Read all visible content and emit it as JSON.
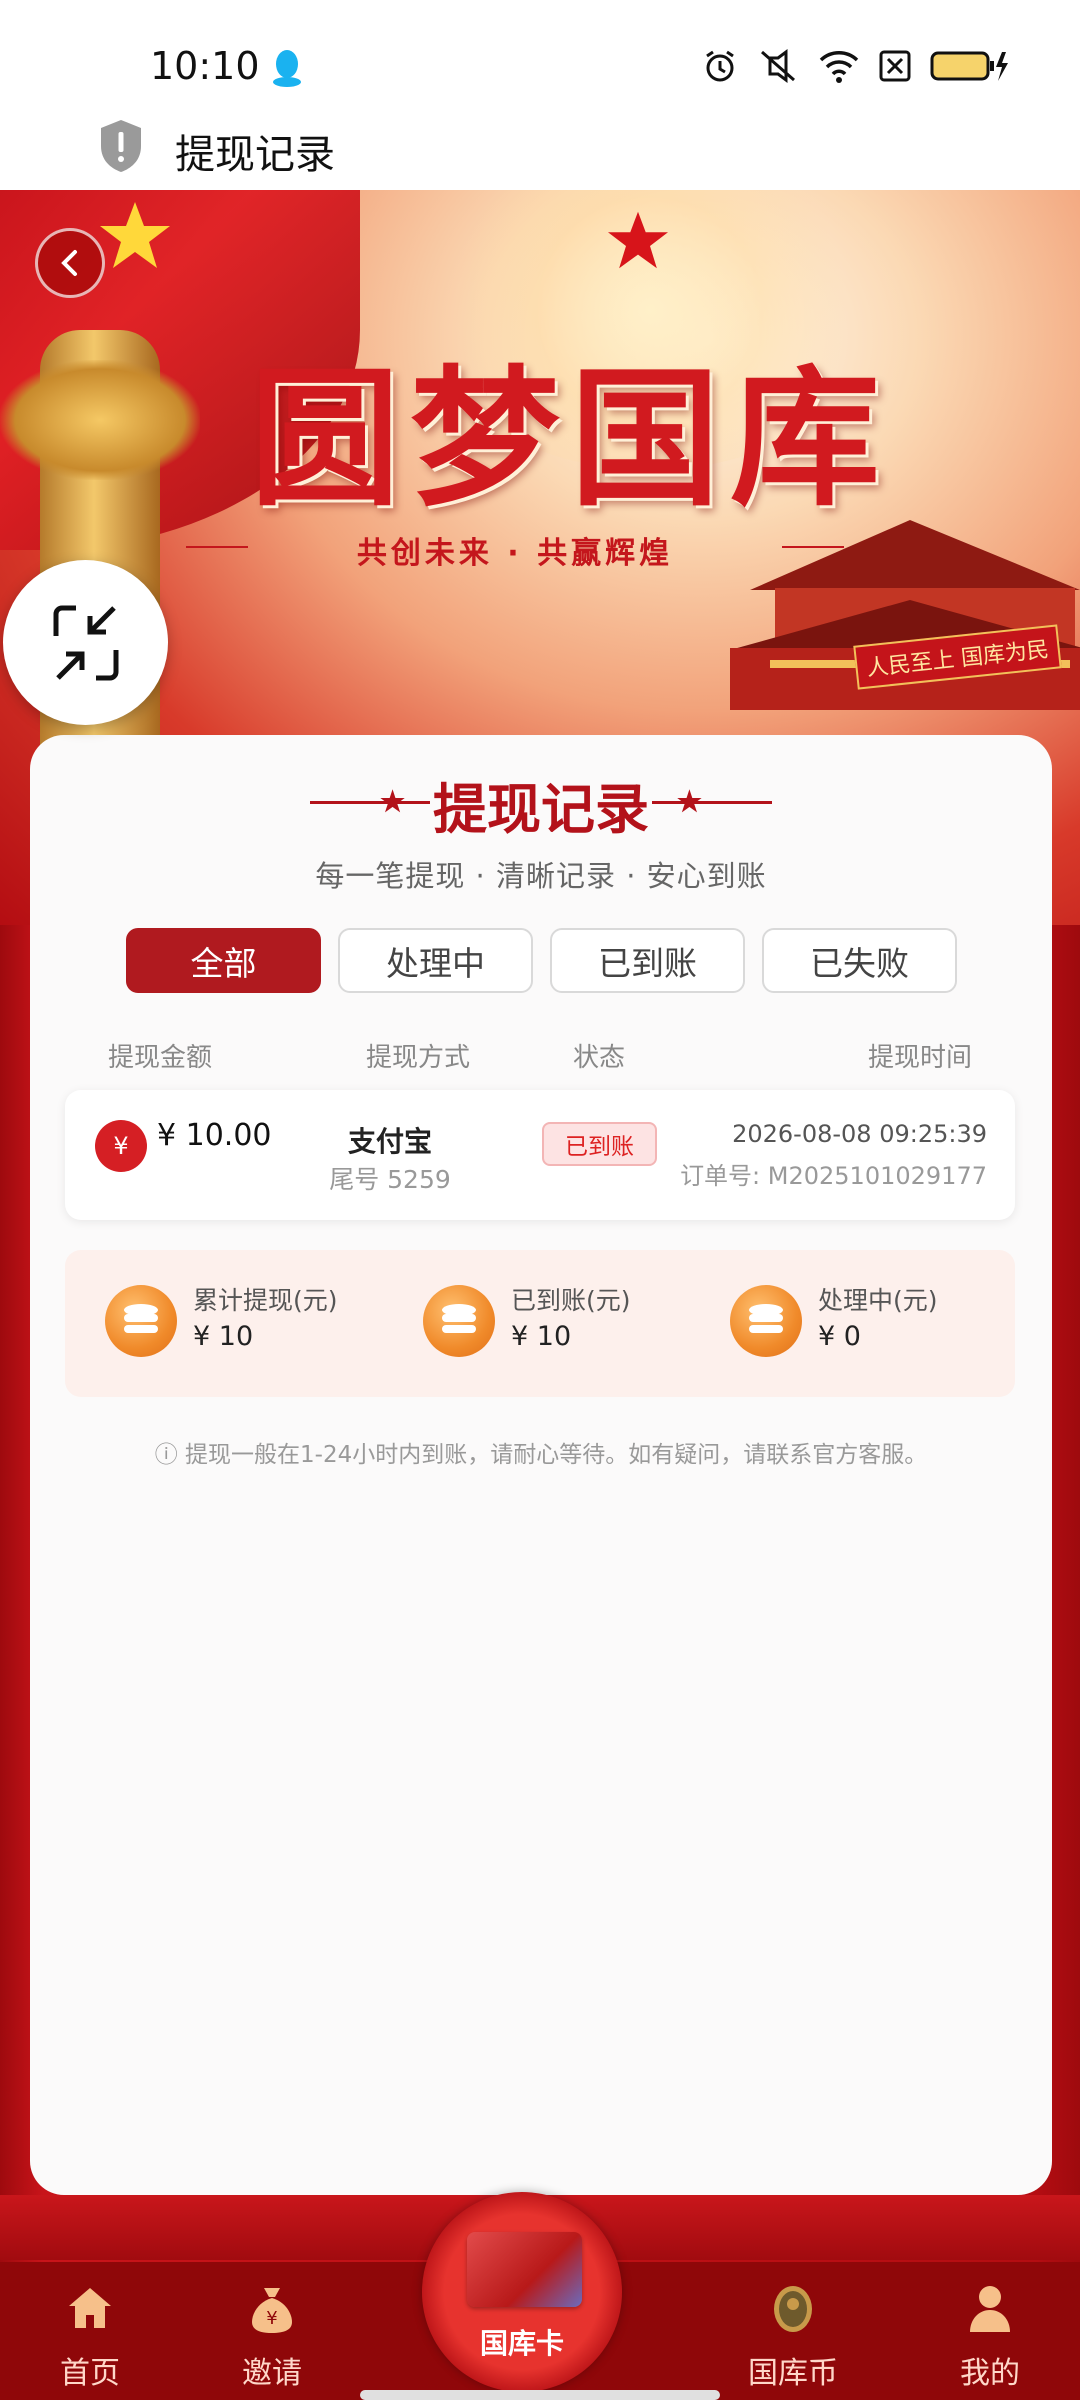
{
  "status_bar": {
    "time": "10:10"
  },
  "header": {
    "title": "提现记录"
  },
  "banner": {
    "headline": "圆梦国库",
    "tagline": "共创未来 · 共赢辉煌",
    "sign_text": "人民至上 国库为民"
  },
  "card": {
    "title": "提现记录",
    "subtitle": "每一笔提现 · 清晰记录 · 安心到账",
    "tabs": [
      {
        "label": "全部",
        "active": true
      },
      {
        "label": "处理中",
        "active": false
      },
      {
        "label": "已到账",
        "active": false
      },
      {
        "label": "已失败",
        "active": false
      }
    ],
    "columns": [
      "提现金额",
      "提现方式",
      "状态",
      "提现时间"
    ],
    "records": [
      {
        "currency_icon": "¥",
        "amount": "¥ 10.00",
        "method": "支付宝",
        "account_tail": "尾号 5259",
        "status": "已到账",
        "time": "2026-08-08 09:25:39",
        "order": "订单号: M2025101029177"
      }
    ],
    "stats": [
      {
        "label": "累计提现(元)",
        "value": "¥ 10"
      },
      {
        "label": "已到账(元)",
        "value": "¥ 10"
      },
      {
        "label": "处理中(元)",
        "value": "¥ 0"
      }
    ],
    "notice": "ⓘ 提现一般在1-24小时内到账，请耐心等待。如有疑问，请联系官方客服。"
  },
  "bottom_nav": {
    "items": [
      {
        "label": "首页",
        "icon": "home-icon"
      },
      {
        "label": "邀请",
        "icon": "money-bag-icon"
      },
      {
        "label": "国库卡",
        "icon": "bank-card-icon"
      },
      {
        "label": "国库币",
        "icon": "coin-icon"
      },
      {
        "label": "我的",
        "icon": "person-icon"
      }
    ]
  },
  "colors": {
    "primary": "#b01a1f",
    "accent": "#f08a2a",
    "background": "#b40d12"
  }
}
